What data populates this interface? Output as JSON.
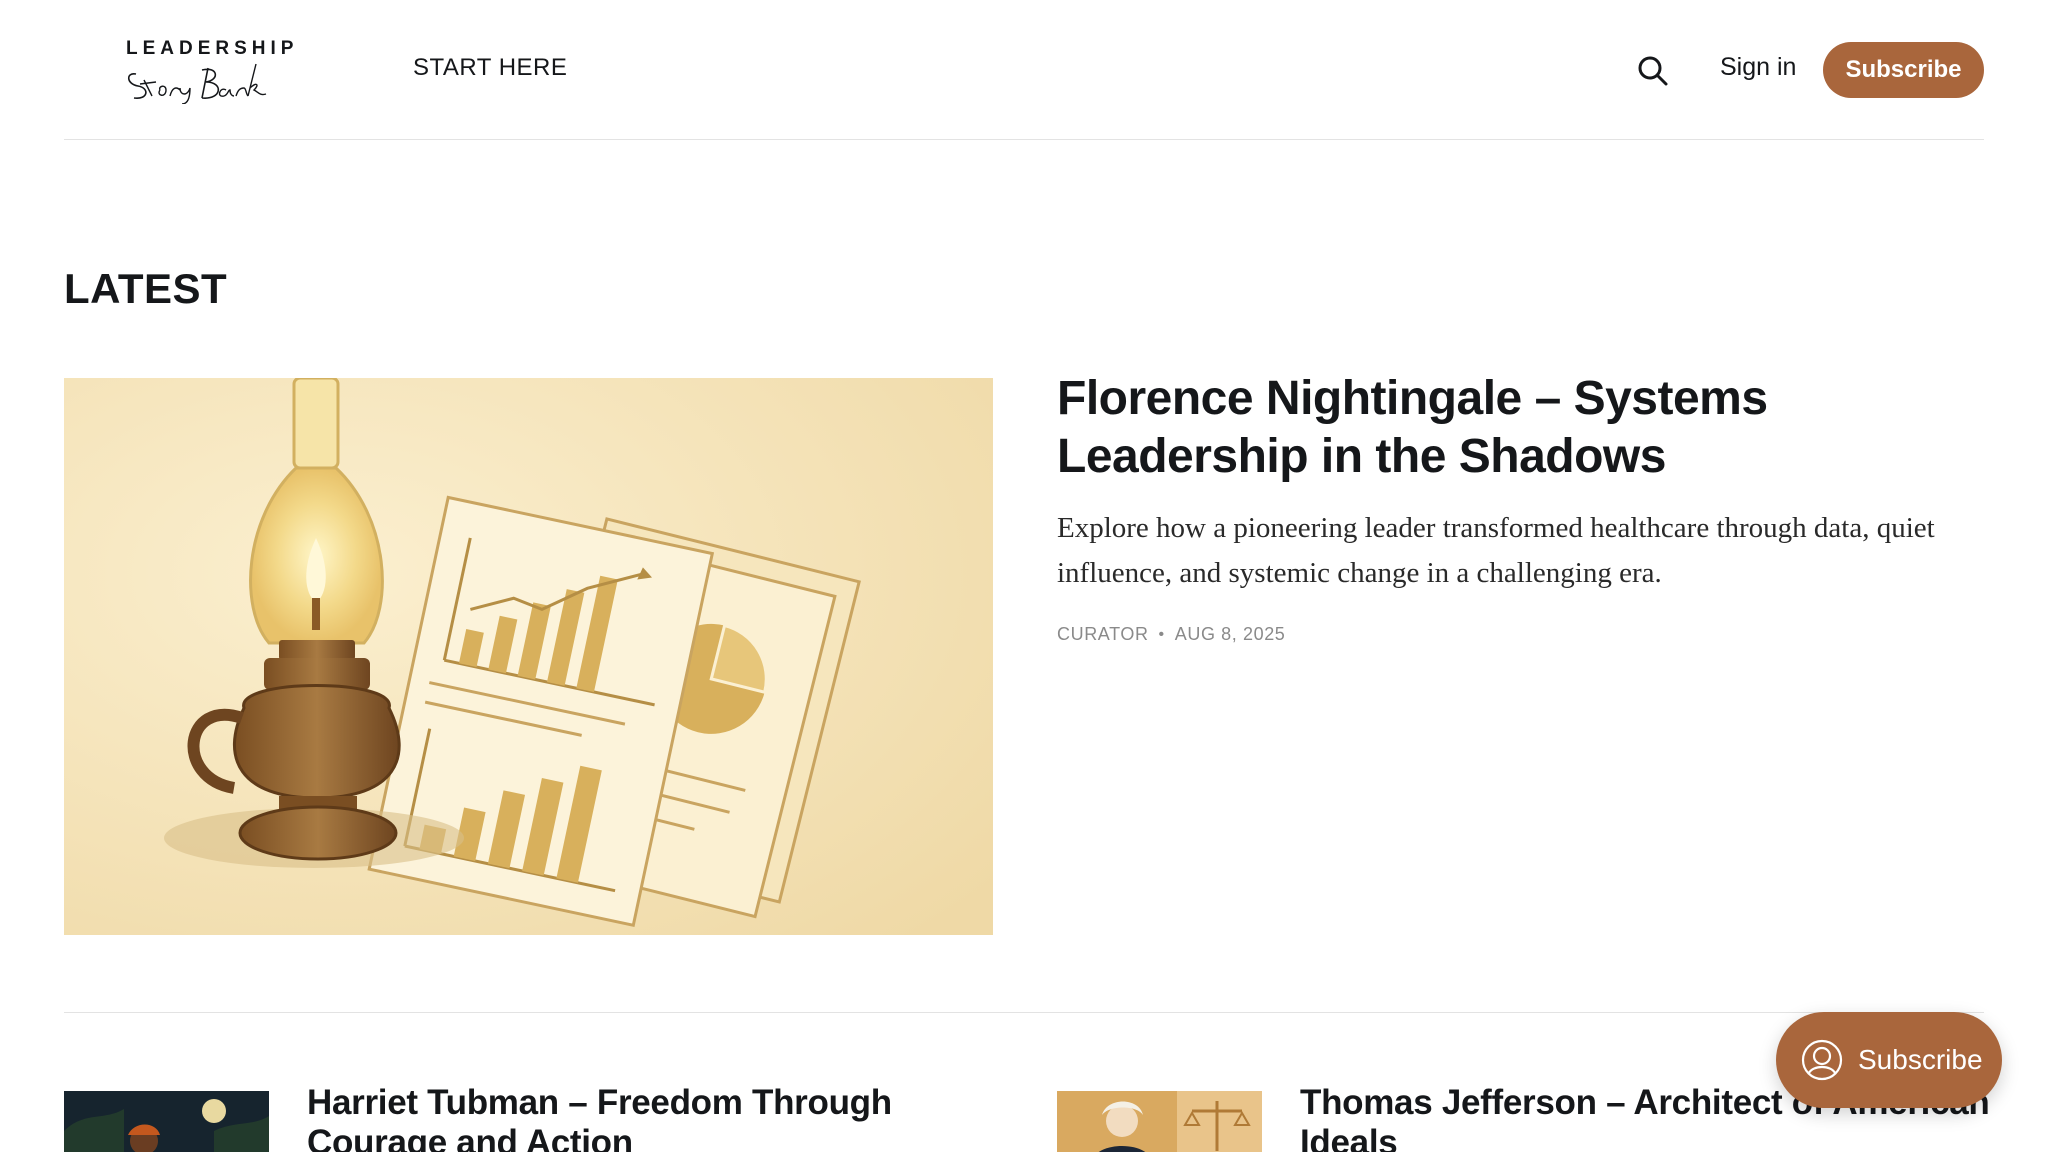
{
  "header": {
    "logo_top": "LEADERSHIP",
    "logo_script": "Story Bank",
    "nav": {
      "start_here": "START HERE"
    },
    "search_icon": "search-icon",
    "sign_in": "Sign in",
    "subscribe": "Subscribe"
  },
  "section": {
    "title": "LATEST"
  },
  "feature": {
    "title": "Florence Nightingale – Systems Leadership in the Shadows",
    "excerpt": "Explore how a pioneering leader transformed healthcare through data, quiet influence, and systemic change in a challenging era.",
    "author": "CURATOR",
    "separator": "•",
    "date": "AUG 8, 2025"
  },
  "cards": [
    {
      "title": "Harriet Tubman – Freedom Through Courage and Action"
    },
    {
      "title": "Thomas Jefferson – Architect of American Ideals"
    }
  ],
  "portal": {
    "label": "Subscribe",
    "icon": "user-circle-icon"
  },
  "colors": {
    "accent": "#a9663c",
    "text": "#15171a",
    "muted": "#8a8a8a",
    "border": "#e3e3e3"
  }
}
